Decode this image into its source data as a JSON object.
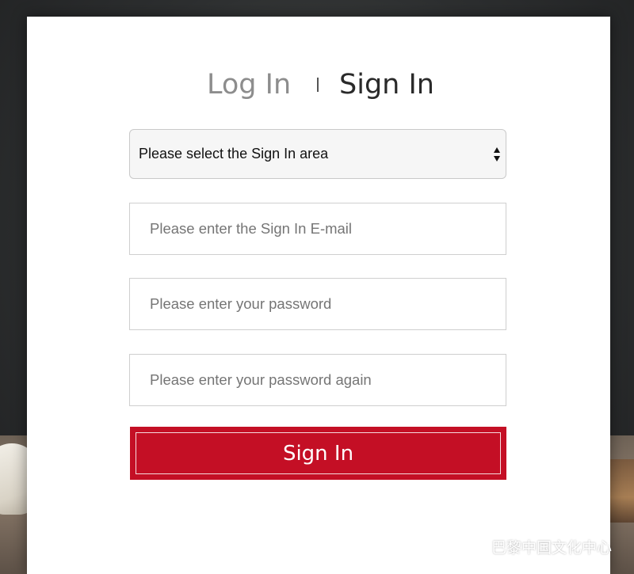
{
  "tabs": {
    "login_label": "Log In",
    "signin_label": "Sign In",
    "active": "signin"
  },
  "form": {
    "area_select": {
      "selected": "Please select the Sign In area"
    },
    "email": {
      "placeholder": "Please enter the Sign In E-mail"
    },
    "password": {
      "placeholder": "Please enter your password"
    },
    "password_again": {
      "placeholder": "Please enter your password again"
    },
    "submit_label": "Sign In"
  },
  "watermark": {
    "text": "巴黎中国文化中心",
    "icon": "wechat-icon"
  },
  "colors": {
    "accent": "#c40f25",
    "tab_inactive": "#8d8d8d",
    "tab_active": "#2a2a2a"
  }
}
